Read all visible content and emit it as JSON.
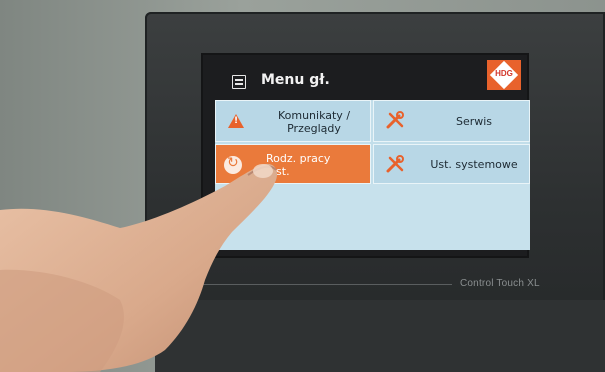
{
  "menu": {
    "title": "Menu gł.",
    "logo_text": "HDG"
  },
  "tiles": [
    {
      "label_line1": "Komunikaty /",
      "label_line2": "Przeglądy",
      "icon": "warning-icon"
    },
    {
      "label_line1": "Serwis",
      "label_line2": "",
      "icon": "wrench-screwdriver-icon"
    },
    {
      "label_line1": "Rodz. pracy",
      "label_line2": "inst.",
      "icon": "cycle-icon"
    },
    {
      "label_line1": "Ust. systemowe",
      "label_line2": "",
      "icon": "wrench-screwdriver-icon"
    }
  ],
  "device": {
    "label": "Control Touch XL"
  },
  "colors": {
    "accent_orange": "#ea7a3b",
    "tile_blue": "#b8d7e6",
    "screen_bg": "#1c1d1f"
  }
}
